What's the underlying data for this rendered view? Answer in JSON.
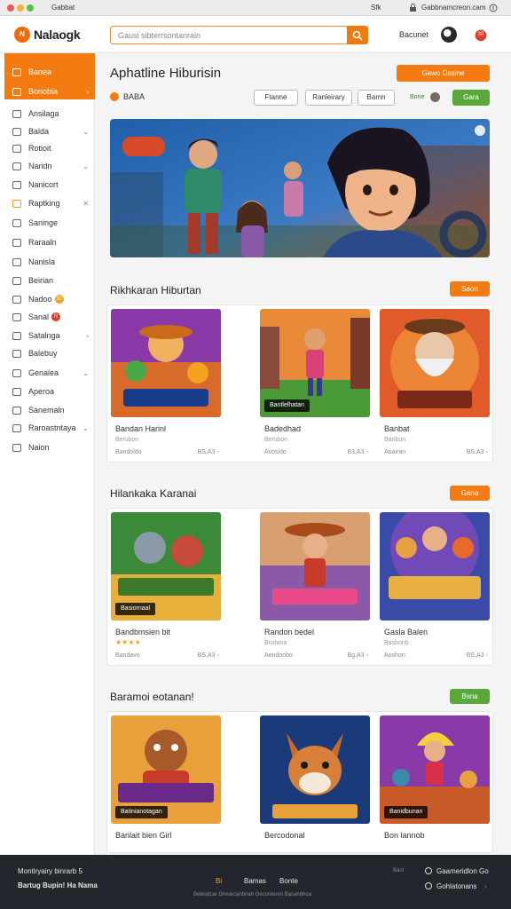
{
  "window": {
    "title": "Gabbat",
    "url_left": "Sfk",
    "url_right": "Gabbnamcreon.cam"
  },
  "header": {
    "logo_mark": "N",
    "logo_text": "Nalaogk",
    "search_placeholder": "Gausi sibterrsontanrain",
    "link": "Bacunet",
    "avatar_badge": "30"
  },
  "sidebar": {
    "items": [
      {
        "label": "Banea",
        "active": true,
        "chevron": ""
      },
      {
        "label": "Bonobia",
        "active": true,
        "chevron": "›"
      },
      {
        "label": "Ansilaga",
        "chevron": ""
      },
      {
        "label": "Balda",
        "chevron": "⌄"
      },
      {
        "label": "Rotioit",
        "chevron": ""
      },
      {
        "label": "Naridn",
        "chevron": "⌄"
      },
      {
        "label": "Nanicort",
        "chevron": ""
      },
      {
        "label": "Raptking",
        "chevron": "✕"
      },
      {
        "label": "Saninge",
        "chevron": ""
      },
      {
        "label": "Raraaln",
        "chevron": ""
      },
      {
        "label": "Nanisla",
        "chevron": ""
      },
      {
        "label": "Beirian",
        "chevron": ""
      },
      {
        "label": "Nadoo",
        "chevron": "",
        "badge": "30",
        "badge_color": "#f4a020"
      },
      {
        "label": "Sanal",
        "chevron": "",
        "badge": "R",
        "badge_color": "#e03a2a"
      },
      {
        "label": "Satalnga",
        "chevron": "›"
      },
      {
        "label": "Balebuy",
        "chevron": ""
      },
      {
        "label": "Genalea",
        "chevron": "⌄"
      },
      {
        "label": "Aperoa",
        "chevron": ""
      },
      {
        "label": "Sanemaln",
        "chevron": ""
      },
      {
        "label": "Raroastntaya",
        "chevron": "⌄"
      },
      {
        "label": "Naion",
        "chevron": ""
      }
    ]
  },
  "main": {
    "title": "Aphatline Hiburisin",
    "primary_button": "Gawo Dasine",
    "filter_label": "BABA",
    "filter_buttons": [
      "Ftanne",
      "Ranleirary",
      "Bamn"
    ],
    "small_text": "Bone",
    "green_button": "Gara"
  },
  "sections": [
    {
      "title": "Rikhkaran Hiburtan",
      "button": "Saon",
      "button_color": "#f47a12",
      "cards": [
        {
          "label": "",
          "title": "Bandan Harinl",
          "stars": "",
          "sub": "Bersbon",
          "meta_l": "Bandoldo",
          "meta_r": "BS,A3 ◦"
        },
        {
          "label": "Bantlelhatan",
          "title": "Badedhad",
          "stars": "",
          "sub": "Bersbon",
          "meta_l": "Avosldo",
          "meta_r": "B3,A3 ◦"
        },
        {
          "label": "",
          "title": "Banbat",
          "stars": "",
          "sub": "Baribun",
          "meta_l": "Aoairan",
          "meta_r": "BS,A3 ◦"
        }
      ]
    },
    {
      "title": "Hilankaka Karanai",
      "button": "Gana",
      "button_color": "#f47a12",
      "cards": [
        {
          "label": "Basiornaal",
          "title": "Bandbmsien bit",
          "stars": "★★★★",
          "sub": "",
          "meta_l": "Bandavo",
          "meta_r": "BS,A3 ◦"
        },
        {
          "label": "",
          "title": "Randon bedel",
          "stars": "",
          "sub": "Bisdana",
          "meta_l": "Aendonbo",
          "meta_r": "Bg,A3 ◦"
        },
        {
          "label": "",
          "title": "Gasla Balen",
          "stars": "",
          "sub": "Basbonb",
          "meta_l": "Aoshon",
          "meta_r": "BS,A3 ◦"
        }
      ]
    },
    {
      "title": "Baramoi eotanan!",
      "button": "Bsna",
      "button_color": "#5aa83a",
      "cards": [
        {
          "label": "Batinianotagan",
          "title": "Banlait bien Girl",
          "stars": "",
          "sub": "",
          "meta_l": "",
          "meta_r": ""
        },
        {
          "label": "",
          "title": "Bercodonal",
          "stars": "",
          "sub": "",
          "meta_l": "",
          "meta_r": ""
        },
        {
          "label": "Banidbunan",
          "title": "Bon lannob",
          "stars": "",
          "sub": "",
          "meta_l": "",
          "meta_r": ""
        }
      ]
    }
  ],
  "footer": {
    "left_top": "Montiryairy binrarb 5",
    "left_bottom": "Bartug Bupin! Ha Nama",
    "center_links": [
      "Bi",
      "Bamas",
      "Bonte"
    ],
    "center_small": "Belesdcar Ghearcanbnah Geconteren Basanbhoa",
    "right_small": "Banl",
    "right_top": "Gaameridlon Go",
    "right_bottom": "Gohlatonans"
  },
  "colors": {
    "accent": "#f47a12",
    "green": "#5aa83a",
    "footer_bg": "#23262c"
  }
}
